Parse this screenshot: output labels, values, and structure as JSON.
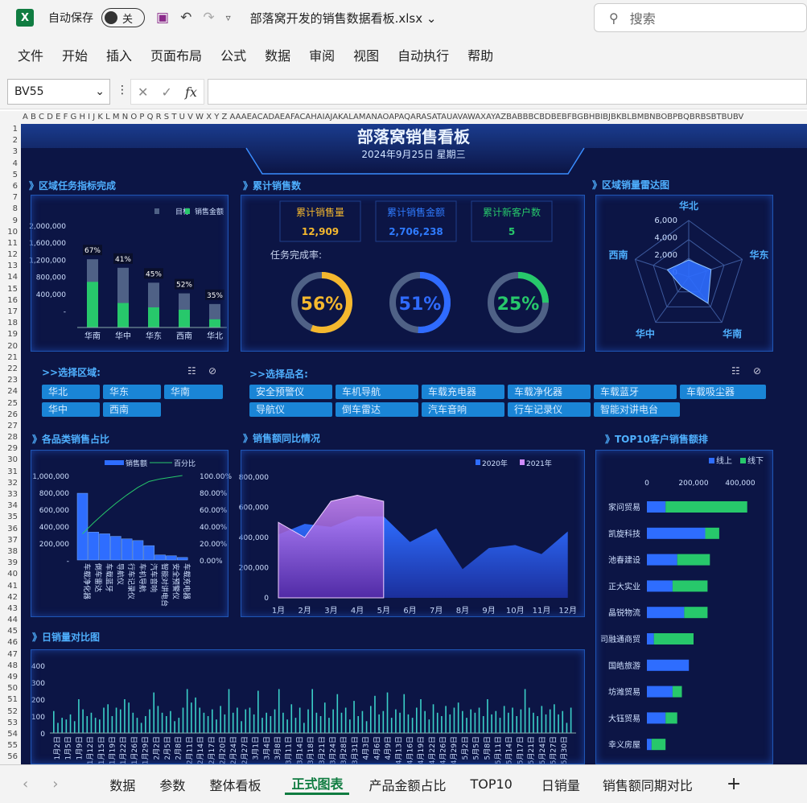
{
  "app": {
    "autosave_label": "自动保存",
    "autosave_state": "关",
    "file_title": "部落窝开发的销售数据看板.xlsx",
    "search_placeholder": "搜索"
  },
  "menu": [
    "文件",
    "开始",
    "插入",
    "页面布局",
    "公式",
    "数据",
    "审阅",
    "视图",
    "自动执行",
    "帮助"
  ],
  "formula_bar": {
    "name_box": "BV55",
    "fx": "fx"
  },
  "column_header_text": "A B C D E F G H I J K L M N O P Q R S T U V W X Y Z AAAEACADAEAFACAHAIAJAKALAMANAOAPAQARASATAUAVAWAXAYAZBABBBCBDBEBFBGBHBIBJBKBLBMBNBOBPBQBRBSBTBUBV",
  "dashboard": {
    "title": "部落窝销售看板",
    "date": "2024年9月25日 星期三",
    "sec1": "》区域任务指标完成",
    "sec2": "》累计销售数",
    "sec3": "》区域销量雷达图",
    "sec4": "》各品类销售占比",
    "sec5": "》销售额同比情况",
    "sec6": "》TOP10客户销售额排",
    "sec7": "》日销量对比图",
    "kpi": [
      {
        "label": "累计销售量",
        "value": "12,909",
        "color": "#f5b82e"
      },
      {
        "label": "累计销售金额",
        "value": "2,706,238",
        "color": "#2f7bff"
      },
      {
        "label": "累计新客户数",
        "value": "5",
        "color": "#27c86b"
      }
    ],
    "task_rate_label": "任务完成率:",
    "gauges": [
      {
        "pct": "56%",
        "frac": 0.56,
        "color": "#f5b82e"
      },
      {
        "pct": "51%",
        "frac": 0.51,
        "color": "#2f6bff"
      },
      {
        "pct": "25%",
        "frac": 0.25,
        "color": "#27c86b"
      }
    ],
    "region_filter_label": ">>选择区域:",
    "product_filter_label": ">>选择品名:",
    "regions": [
      "华北",
      "华东",
      "华南",
      "华中",
      "西南"
    ],
    "products": [
      "安全预警仪",
      "车机导航",
      "车载充电器",
      "车载净化器",
      "车载蓝牙",
      "车载吸尘器",
      "导航仪",
      "倒车雷达",
      "汽车音响",
      "行车记录仪",
      "智能对讲电台"
    ]
  },
  "chart_data": [
    {
      "type": "bar",
      "categories": [
        "华南",
        "华中",
        "华东",
        "西南",
        "华北"
      ],
      "series": [
        {
          "name": "目标",
          "values": [
            1600000,
            1400000,
            1050000,
            800000,
            550000
          ]
        },
        {
          "name": "销售金额",
          "values": [
            1070000,
            574000,
            472000,
            416000,
            192000
          ]
        }
      ],
      "data_labels": [
        "67%",
        "41%",
        "45%",
        "52%",
        "35%"
      ],
      "ytick_labels": [
        "2,000,000",
        "1,600,000",
        "1,200,000",
        "800,000",
        "400,000",
        "-"
      ],
      "ylim": [
        0,
        2000000
      ]
    },
    {
      "type": "radar",
      "axes": [
        "华北",
        "华东",
        "华南",
        "华中",
        "西南"
      ],
      "values": [
        1800,
        2500,
        3500,
        1300,
        2400
      ],
      "ytick_labels": [
        "6,000",
        "4,000",
        "2,000",
        "0"
      ],
      "rmax": 6000
    },
    {
      "type": "bar",
      "categories": [
        "车载净化器",
        "倒车雷达",
        "车载蓝牙",
        "导航仪",
        "行车记录仪",
        "车机导航",
        "汽车音响",
        "智能对讲电台",
        "安全预警仪",
        "车载充电器"
      ],
      "series": [
        {
          "name": "销售额",
          "values": [
            790000,
            330000,
            310000,
            280000,
            250000,
            230000,
            170000,
            60000,
            50000,
            30000
          ]
        },
        {
          "name": "百分比",
          "values": [
            0.31,
            0.44,
            0.56,
            0.67,
            0.77,
            0.86,
            0.93,
            0.96,
            0.98,
            1.0
          ]
        }
      ],
      "ytick_labels": [
        "1,000,000",
        "800,000",
        "600,000",
        "400,000",
        "200,000",
        "-"
      ],
      "y2tick_labels": [
        "100.00%",
        "80.00%",
        "60.00%",
        "40.00%",
        "20.00%",
        "0.00%"
      ],
      "ylim": [
        0,
        1000000
      ]
    },
    {
      "type": "area",
      "categories": [
        "1月",
        "2月",
        "3月",
        "4月",
        "5月",
        "6月",
        "7月",
        "8月",
        "9月",
        "10月",
        "11月",
        "12月"
      ],
      "series": [
        {
          "name": "2020年",
          "values": [
            420000,
            490000,
            470000,
            540000,
            540000,
            370000,
            460000,
            190000,
            330000,
            350000,
            290000,
            440000
          ]
        },
        {
          "name": "2021年",
          "values": [
            500000,
            400000,
            640000,
            680000,
            640000
          ]
        }
      ],
      "ytick_labels": [
        "800,000",
        "600,000",
        "400,000",
        "200,000",
        "0"
      ],
      "ylim": [
        0,
        800000
      ]
    },
    {
      "type": "bar",
      "categories": [
        "家问贸易",
        "凯旋科技",
        "池春建设",
        "正大实业",
        "晶锐物流",
        "司融通商贸",
        "国皓旅游",
        "坊潍贸易",
        "大钰贸易",
        "幸义房屋"
      ],
      "series": [
        {
          "name": "线上",
          "values": [
            80000,
            250000,
            130000,
            110000,
            160000,
            30000,
            180000,
            110000,
            80000,
            20000
          ]
        },
        {
          "name": "线下",
          "values": [
            350000,
            60000,
            140000,
            150000,
            100000,
            170000,
            0,
            40000,
            50000,
            60000
          ]
        }
      ],
      "xtick_labels": [
        "0",
        "200,000",
        "400,000"
      ],
      "xlim": [
        0,
        500000
      ]
    },
    {
      "type": "bar",
      "x_labels": [
        "1月2日",
        "1月5日",
        "1月9日",
        "1月12日",
        "1月15日",
        "1月19日",
        "1月22日",
        "1月26日",
        "1月29日",
        "2月2日",
        "2月5日",
        "2月8日",
        "2月11日",
        "2月14日",
        "2月17日",
        "2月20日",
        "2月24日",
        "2月27日",
        "3月1日",
        "3月4日",
        "3月8日",
        "3月11日",
        "3月14日",
        "3月18日",
        "3月21日",
        "3月24日",
        "3月28日",
        "3月31日",
        "4月3日",
        "4月6日",
        "4月9日",
        "4月13日",
        "4月16日",
        "4月19日",
        "4月22日",
        "4月26日",
        "4月29日",
        "5月2日",
        "5月5日",
        "5月8日",
        "5月11日",
        "5月14日",
        "5月17日",
        "5月21日",
        "5月24日",
        "5月27日",
        "5月30日"
      ],
      "values": [
        130,
        60,
        90,
        80,
        110,
        70,
        200,
        140,
        100,
        120,
        90,
        80,
        150,
        170,
        100,
        150,
        140,
        200,
        180,
        120,
        90,
        60,
        100,
        140,
        240,
        160,
        120,
        100,
        130,
        70,
        90,
        150,
        260,
        180,
        210,
        150,
        120,
        100,
        140,
        80,
        160,
        110,
        260,
        120,
        150,
        70,
        140,
        150,
        110,
        250,
        90,
        120,
        100,
        140,
        260,
        120,
        80,
        170,
        90,
        150,
        60,
        140,
        260,
        120,
        100,
        180,
        90,
        140,
        230,
        120,
        150,
        80,
        190,
        100,
        130,
        70,
        160,
        220,
        110,
        130,
        240,
        90,
        140,
        120,
        230,
        110,
        90,
        150,
        200,
        130,
        80,
        170,
        120,
        100,
        160,
        110,
        150,
        180,
        130,
        90,
        140,
        120,
        150,
        100,
        200,
        110,
        130,
        90,
        160,
        120,
        150,
        100,
        140,
        260,
        150,
        120,
        100,
        160,
        110,
        140,
        170,
        110,
        130,
        60,
        150
      ],
      "ytick_labels": [
        "400",
        "300",
        "200",
        "100",
        "0"
      ],
      "ylim": [
        0,
        400
      ]
    }
  ],
  "sheets": [
    "数据",
    "参数",
    "整体看板",
    "正式图表",
    "产品金额占比",
    "TOP10",
    "日销量",
    "销售额同期对比"
  ],
  "active_sheet": "正式图表"
}
